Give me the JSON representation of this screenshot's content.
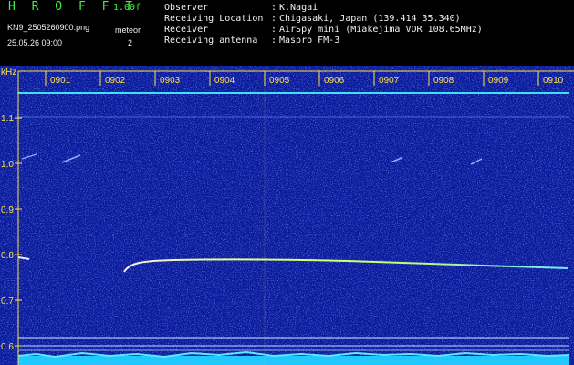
{
  "header": {
    "app_title": "H R O F F T",
    "version": "1.00f",
    "file_name": "KN9_2505260900.png",
    "meteor_label": "meteor",
    "meteor_count": "2",
    "datetime": "25.05.26 09:00",
    "info": [
      {
        "key": "Observer",
        "value": "K.Nagai"
      },
      {
        "key": "Receiving Location",
        "value": "Chigasaki, Japan (139.414 35.340)"
      },
      {
        "key": "Receiver",
        "value": "AirSpy mini (Miakejima VOR 108.65MHz)"
      },
      {
        "key": "Receiving antenna",
        "value": "Maspro FM-3"
      }
    ],
    "separator": ":"
  },
  "spectrogram": {
    "y_unit": "kHz",
    "y_ticks": [
      "1.1",
      "1.0",
      "0.9",
      "0.8",
      "0.7",
      "0.6"
    ],
    "x_ticks": [
      "0901",
      "0902",
      "0903",
      "0904",
      "0905",
      "0906",
      "0907",
      "0908",
      "0909",
      "0910"
    ],
    "colors": {
      "background": "#0a1a9a",
      "noise": "#3050e0",
      "tick": "#ffe040",
      "carrier": "#40e0ff",
      "echo": "#e0ff90",
      "baseline": "#20c8ff"
    }
  }
}
